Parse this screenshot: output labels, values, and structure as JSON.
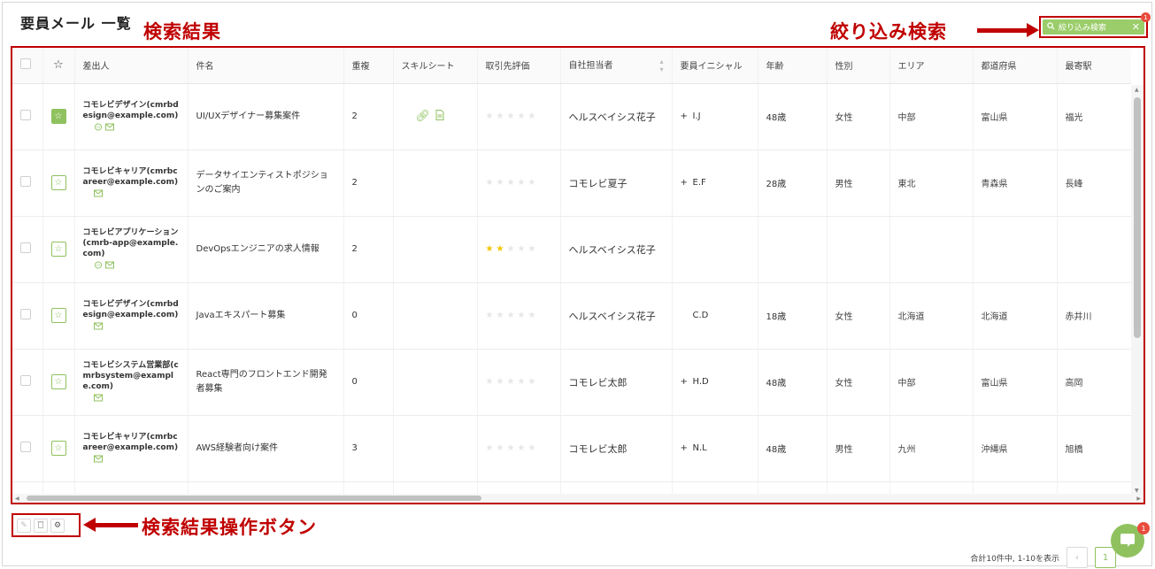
{
  "page": {
    "title": "要員メール 一覧"
  },
  "annotations": {
    "results": "検索結果",
    "filter": "絞り込み検索",
    "ops": "検索結果操作ボタン"
  },
  "filter": {
    "label": "絞り込み検索",
    "badge": "1",
    "icon": "search-icon",
    "close_icon": "close-icon"
  },
  "table": {
    "columns": [
      "差出人",
      "件名",
      "重複",
      "スキルシート",
      "取引先評価",
      "自社担当者",
      "要員イニシャル",
      "年齢",
      "性別",
      "エリア",
      "都道府県",
      "最寄駅"
    ],
    "rows": [
      {
        "starred": true,
        "sender": "コモレビデザイン(cmrbdesign@example.com)",
        "icons": [
          "chat-icon",
          "mail-icon"
        ],
        "subject": "UI/UXデザイナー募集案件",
        "dup": "2",
        "skill": true,
        "rating": 0,
        "staff": "ヘルスベイシス花子",
        "plus": "+",
        "initial": "I.J",
        "age": "48歳",
        "gender": "女性",
        "area": "中部",
        "pref": "富山県",
        "station": "福光"
      },
      {
        "starred": false,
        "sender": "コモレビキャリア(cmrbcareer@example.com)",
        "icons": [
          "mail-icon"
        ],
        "subject": "データサイエンティストポジションのご案内",
        "dup": "2",
        "skill": false,
        "rating": 0,
        "staff": "コモレビ夏子",
        "plus": "+",
        "initial": "E.F",
        "age": "28歳",
        "gender": "男性",
        "area": "東北",
        "pref": "青森県",
        "station": "長峰"
      },
      {
        "starred": false,
        "sender": "コモレビアプリケーション(cmrb-app@example.com)",
        "icons": [
          "chat-icon",
          "mail-icon"
        ],
        "subject": "DevOpsエンジニアの求人情報",
        "dup": "2",
        "skill": false,
        "rating": 2,
        "staff": "ヘルスベイシス花子",
        "plus": "",
        "initial": "",
        "age": "",
        "gender": "",
        "area": "",
        "pref": "",
        "station": ""
      },
      {
        "starred": false,
        "sender": "コモレビデザイン(cmrbdesign@example.com)",
        "icons": [
          "mail-icon"
        ],
        "subject": "Javaエキスパート募集",
        "dup": "0",
        "skill": false,
        "rating": 0,
        "staff": "ヘルスベイシス花子",
        "plus": "",
        "initial": "C.D",
        "age": "18歳",
        "gender": "女性",
        "area": "北海道",
        "pref": "北海道",
        "station": "赤井川"
      },
      {
        "starred": false,
        "sender": "コモレビシステム営業部(cmrbsystem@example.com)",
        "icons": [
          "mail-icon"
        ],
        "subject": "React専門のフロントエンド開発者募集",
        "dup": "0",
        "skill": false,
        "rating": 0,
        "staff": "コモレビ太郎",
        "plus": "+",
        "initial": "H.D",
        "age": "48歳",
        "gender": "女性",
        "area": "中部",
        "pref": "富山県",
        "station": "高岡"
      },
      {
        "starred": false,
        "sender": "コモレビキャリア(cmrbcareer@example.com)",
        "icons": [
          "mail-icon"
        ],
        "subject": "AWS経験者向け案件",
        "dup": "3",
        "skill": false,
        "rating": 0,
        "staff": "コモレビ太郎",
        "plus": "+",
        "initial": "N.L",
        "age": "48歳",
        "gender": "男性",
        "area": "九州",
        "pref": "沖縄県",
        "station": "旭橋"
      }
    ]
  },
  "ops": {
    "buttons": [
      "edit-icon",
      "trash-icon",
      "gear-icon"
    ]
  },
  "pager": {
    "summary": "合計10件中, 1-10を表示",
    "current": "1"
  },
  "chat": {
    "badge": "1"
  },
  "colors": {
    "accent": "#8fc25f",
    "annotation": "#c00000",
    "badge": "#e84c3d",
    "star": "#f2c500"
  }
}
